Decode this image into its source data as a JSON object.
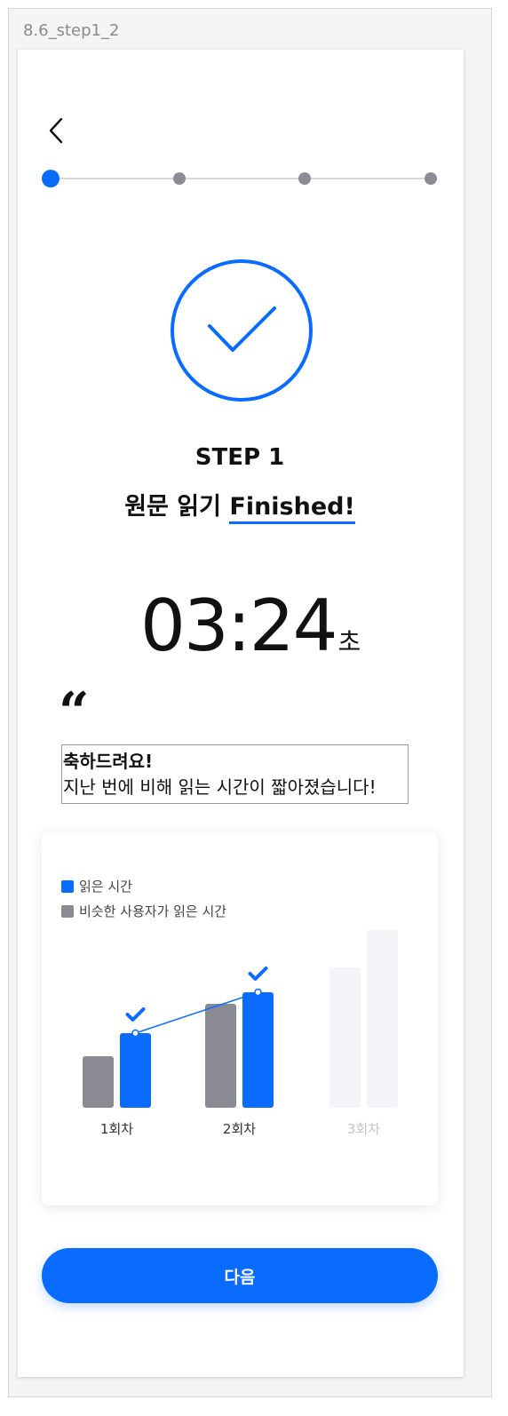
{
  "frame": {
    "label": "8.6_step1_2"
  },
  "nav": {
    "back_icon": "chevron-left-icon"
  },
  "progress": {
    "total_steps": 4,
    "current_step": 1
  },
  "status": {
    "icon": "check-circle-icon",
    "step_title": "STEP 1",
    "task_prefix": "원문 읽기 ",
    "task_status": "Finished!"
  },
  "timer": {
    "value": "03:24",
    "unit": "초"
  },
  "message": {
    "quote_mark": "“",
    "line1": "축하드려요!",
    "line2": "지난 번에 비해 읽는 시간이 짧아졌습니다!"
  },
  "colors": {
    "accent": "#0a6cff",
    "gray": "#8a8a92",
    "faded": "#f3f4f8"
  },
  "chart_data": {
    "type": "bar",
    "legend": [
      "읽은 시간",
      "비슷한 사용자가 읽은 시간"
    ],
    "categories": [
      "1회차",
      "2회차",
      "3회차"
    ],
    "series": [
      {
        "name": "읽은 시간",
        "values": [
          84,
          130,
          200
        ]
      },
      {
        "name": "비슷한 사용자가 읽은 시간",
        "values": [
          58,
          117,
          158
        ]
      }
    ],
    "check_marks": [
      true,
      true,
      false
    ],
    "faded_categories": [
      false,
      false,
      true
    ],
    "trend_line": true
  },
  "actions": {
    "next_label": "다음"
  }
}
